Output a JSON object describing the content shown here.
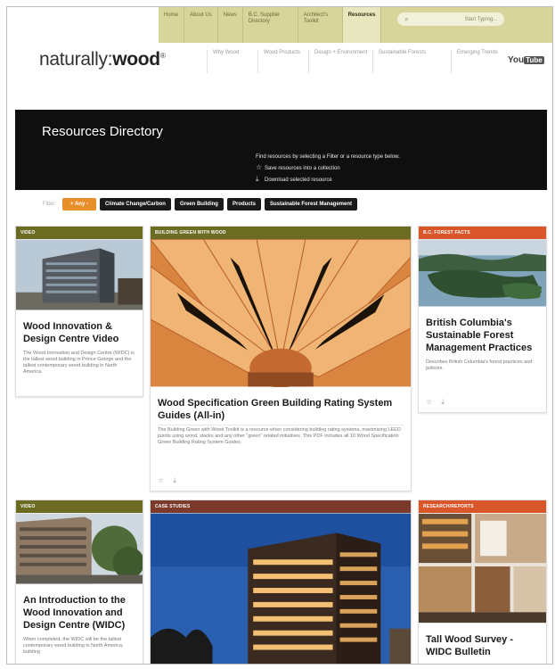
{
  "topbar": {
    "items": [
      "Home",
      "About Us",
      "News",
      "B.C. Supplier Directory",
      "Architect's Toolkit",
      "Resources"
    ],
    "active_index": 5,
    "search_placeholder": "Start Typing..."
  },
  "logo": {
    "prefix": "naturally:",
    "bold": "wood",
    "mark": "®"
  },
  "mainnav": {
    "items": [
      "Why Wood",
      "Wood Products",
      "Design + Environment",
      "Sustainable Forests",
      "Emerging Trends"
    ]
  },
  "social": {
    "label": "You",
    "badge": "Tube"
  },
  "banner": {
    "title": "Resources Directory",
    "line1": "Find resources by selecting a Filter or a resource type below.",
    "line2": "Save resources into a collection",
    "line3": "Download selected resource"
  },
  "filters": {
    "label": "Filter:",
    "buttons": [
      "+ Any -",
      "Climate Change/Carbon",
      "Green Building",
      "Products",
      "Sustainable Forest Management"
    ]
  },
  "cards": [
    {
      "tag": "VIDEO",
      "title": "Wood Innovation & Design Centre Video",
      "desc": "The Wood Innovation and Design Centre (WIDC) is the tallest wood building in Prince George and the tallest contemporary wood building in North America."
    },
    {
      "tag": "BUILDING GREEN WITH WOOD",
      "title": "Wood Specification Green Building Rating System Guides (All-in)",
      "desc": "The Building Green with Wood Toolkit is a resource when considering building rating systems, maximizing LEED points using wood, stacks and any other \"green\" related initiatives. This PDF includes all 10 Wood Specification Green Building Rating System Guides."
    },
    {
      "tag": "B.C. FOREST FACTS",
      "title": "British Columbia's Sustainable Forest Management Practices",
      "desc": "Describes British Columbia's forest practices and policies."
    },
    {
      "tag": "VIDEO",
      "title": "An Introduction to the Wood Innovation and Design Centre (WIDC)",
      "desc": "When completed, the WIDC will be the tallest contemporary wood building in North America, building"
    },
    {
      "tag": "CASE STUDIES"
    },
    {
      "tag": "RESEARCH/REPORTS",
      "title": "Tall Wood Survey - WIDC Bulletin"
    }
  ],
  "icons": {
    "star": "☆",
    "download": "⤓"
  },
  "colors": {
    "accent_orange": "#e88f2a",
    "topbar": "#d7d59a",
    "tag_green": "#6b6b22",
    "tag_orange": "#d9552a",
    "tag_brown": "#7c3a2b"
  }
}
